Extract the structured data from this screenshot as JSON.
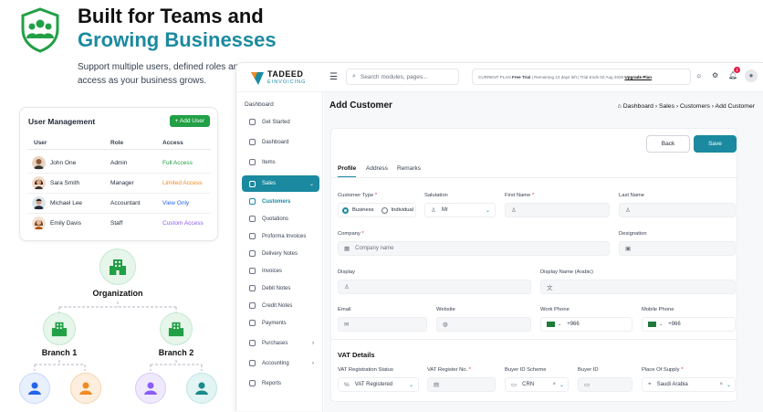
{
  "hero": {
    "title_line1": "Built for Teams and",
    "title_line2": "Growing Businesses",
    "subtitle_line1": "Support multiple users, defined roles and c",
    "subtitle_line2": "access as your business grows."
  },
  "user_management": {
    "title": "User Management",
    "add_button": "+ Add User",
    "columns": [
      "User",
      "Role",
      "Access"
    ],
    "rows": [
      {
        "name": "John One",
        "role": "Admin",
        "access": "Full Access",
        "access_color": "#22a046"
      },
      {
        "name": "Sara Smith",
        "role": "Manager",
        "access": "Limited Access",
        "access_color": "#f08a24"
      },
      {
        "name": "Michael Lee",
        "role": "Accountant",
        "access": "View Only",
        "access_color": "#2563eb"
      },
      {
        "name": "Emily Davis",
        "role": "Staff",
        "access": "Custom Access",
        "access_color": "#8b5cf6"
      }
    ]
  },
  "org": {
    "root": "Organization",
    "branch1": "Branch 1",
    "branch2": "Branch 2"
  },
  "app": {
    "logo_name": "TADEED",
    "logo_sub": "EINVOICING",
    "search_placeholder": "Search modules, pages...",
    "plan_label": "CURRENT PLAN",
    "plan_name": "Free Trial",
    "plan_info": "| Remaining 13 days left | Trial Ends 02 Aug 2026",
    "upgrade": "Upgrade Plan",
    "notification_count": "1",
    "sidebar": {
      "section": "Dashboard",
      "items": [
        "Get Started",
        "Dashboard",
        "Items"
      ],
      "sales": "Sales",
      "sales_items": [
        "Customers",
        "Quotations",
        "Proforma Invoices",
        "Delivery Notes",
        "Invoices",
        "Debit Notes",
        "Credit Notes",
        "Payments"
      ],
      "bottom_items": [
        "Purchases",
        "Accounting",
        "Reports"
      ]
    },
    "page_title": "Add Customer",
    "breadcrumb": "Dashboard  ›  Sales  ›  Customers  ›  Add Customer",
    "back": "Back",
    "save": "Save",
    "tabs": [
      "Profile",
      "Address",
      "Remarks"
    ],
    "form": {
      "customer_type": "Customer Type",
      "business": "Business",
      "individual": "Individual",
      "salutation": "Salutation",
      "salutation_value": "Mr",
      "first_name": "First Name",
      "last_name": "Last Name",
      "company": "Company",
      "company_placeholder": "Company name",
      "designation": "Designation",
      "display": "Display",
      "display_arabic": "Display Name (Arabic)",
      "email": "Email",
      "website": "Website",
      "work_phone": "Work Phone",
      "mobile_phone": "Mobile Phone",
      "phone_code": "+966",
      "vat_title": "VAT Details",
      "vat_status": "VAT Registration Status",
      "vat_status_value": "VAT Registered",
      "vat_no": "VAT Register No.",
      "buyer_scheme": "Buyer ID Scheme",
      "buyer_scheme_value": "CRN",
      "buyer_id": "Buyer ID",
      "place_supply": "Place Of Supply",
      "place_supply_value": "Saudi Arabia"
    }
  }
}
